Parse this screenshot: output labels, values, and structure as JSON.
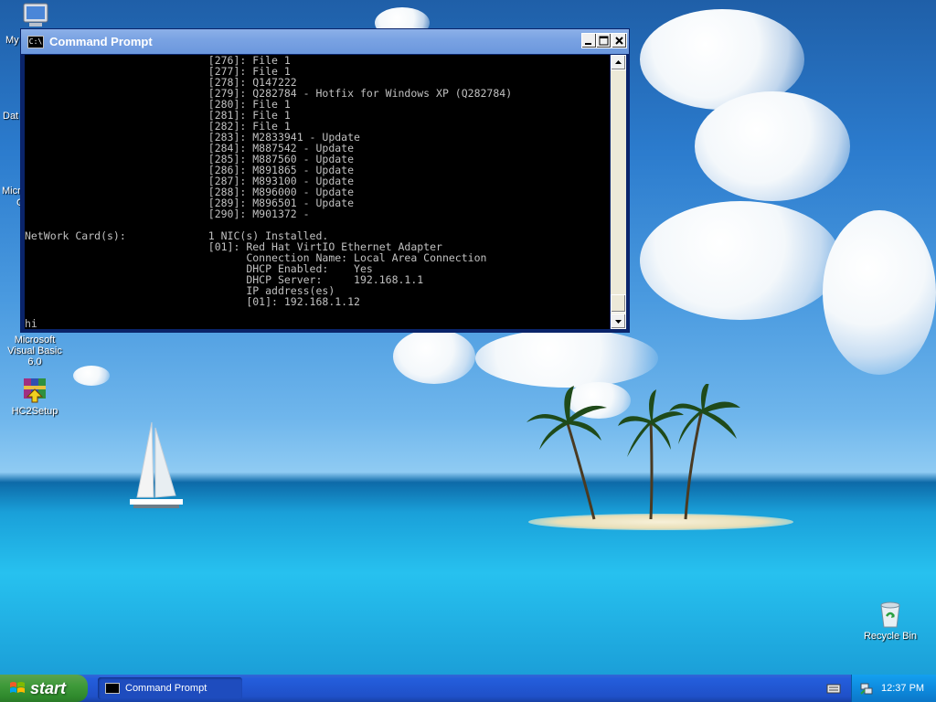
{
  "desktop": {
    "icons": [
      {
        "label": "Microsoft Visual Basic 6.0"
      },
      {
        "label": "HC2Setup"
      },
      {
        "label": "Recycle Bin"
      }
    ],
    "partial_labels": [
      "My",
      "Dat",
      "Micro",
      "C"
    ]
  },
  "cmd_window": {
    "title": "Command Prompt",
    "icon_text": "C:\\",
    "console_lines": [
      "                             [276]: File 1",
      "                             [277]: File 1",
      "                             [278]: Q147222",
      "                             [279]: Q282784 - Hotfix for Windows XP (Q282784)",
      "                             [280]: File 1",
      "                             [281]: File 1",
      "                             [282]: File 1",
      "                             [283]: M2833941 - Update",
      "                             [284]: M887542 - Update",
      "                             [285]: M887560 - Update",
      "                             [286]: M891865 - Update",
      "                             [287]: M893100 - Update",
      "                             [288]: M896000 - Update",
      "                             [289]: M896501 - Update",
      "                             [290]: M901372 -",
      "",
      "NetWork Card(s):             1 NIC(s) Installed.",
      "                             [01]: Red Hat VirtIO Ethernet Adapter",
      "                                   Connection Name: Local Area Connection",
      "                                   DHCP Enabled:    Yes",
      "                                   DHCP Server:     192.168.1.1",
      "                                   IP address(es)",
      "                                   [01]: 192.168.1.12",
      "",
      "hi"
    ]
  },
  "taskbar": {
    "start_label": "start",
    "task_label": "Command Prompt",
    "clock": "12:37 PM"
  },
  "icons": {
    "window_controls": [
      "minimize-icon",
      "maximize-icon",
      "close-icon"
    ],
    "tray": [
      "keyboard-icon",
      "network-icon"
    ],
    "desktop": [
      "computer-icon",
      "winrar-icon",
      "recycle-bin-icon"
    ]
  },
  "colors": {
    "titlebar": "#7aa3e3",
    "console_bg": "#000000",
    "console_text": "#c0c0c0",
    "taskbar": "#245edc",
    "start": "#3f9a3a"
  }
}
